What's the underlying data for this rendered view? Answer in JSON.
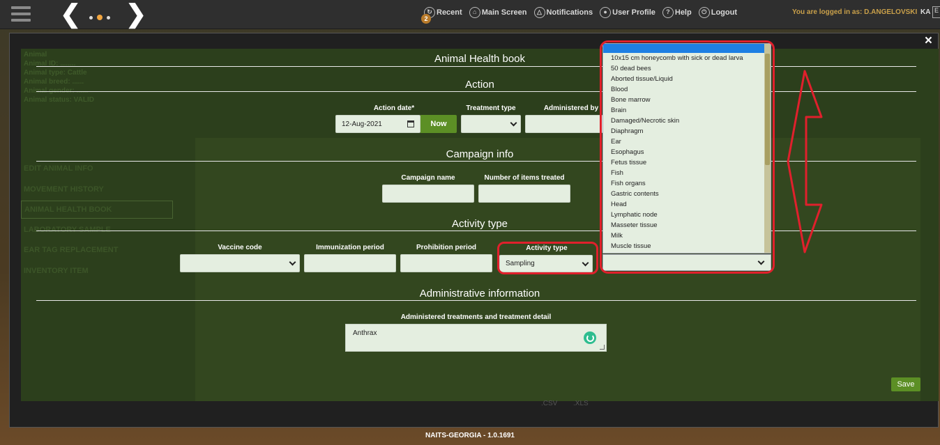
{
  "topbar": {
    "menu": [
      {
        "icon": "recent-icon",
        "label": "Recent",
        "badge": "2"
      },
      {
        "icon": "home-icon",
        "label": "Main Screen"
      },
      {
        "icon": "bell-icon",
        "label": "Notifications"
      },
      {
        "icon": "user-icon",
        "label": "User Profile"
      },
      {
        "icon": "help-icon",
        "label": "Help"
      },
      {
        "icon": "power-icon",
        "label": "Logout"
      }
    ],
    "logged_in": "You are logged in as: D.ANGELOVSKI",
    "lang": "KA",
    "lang_box": "E"
  },
  "background_page": {
    "menu_items": [
      "EDIT ANIMAL INFO",
      "MOVEMENT HISTORY",
      "ANIMAL HEALTH BOOK",
      "LABORATORY SAMPLE",
      "EAR TAG REPLACEMENT",
      "INVENTORY ITEM"
    ],
    "export_labels": [
      ".CSV",
      ".XLS"
    ]
  },
  "modal": {
    "title": "Animal Health book",
    "close": "×",
    "sections": {
      "action": "Action",
      "campaign": "Campaign info",
      "activity": "Activity type",
      "admin": "Administrative information"
    },
    "action": {
      "date_label": "Action date*",
      "date_value": "12-Aug-2021",
      "now_label": "Now",
      "treatment_label": "Treatment type",
      "administered_label": "Administered by"
    },
    "campaign": {
      "name_label": "Campaign name",
      "items_label": "Number of items treated"
    },
    "activity": {
      "vaccine_label": "Vaccine code",
      "immunization_label": "Immunization period",
      "prohibition_label": "Prohibition period",
      "activity_label": "Activity type",
      "activity_value": "Sampling"
    },
    "admin": {
      "detail_label": "Administered treatments and treatment detail",
      "detail_value": "Anthrax"
    },
    "save_label": "Save"
  },
  "dropdown": {
    "options": [
      "10x15 cm honeycomb with sick or dead larva",
      "50 dead bees",
      "Aborted tissue/Liquid",
      "Blood",
      "Bone marrow",
      "Brain",
      "Damaged/Necrotic skin",
      "Diaphragm",
      "Ear",
      "Esophagus",
      "Fetus tissue",
      "Fish",
      "Fish organs",
      "Gastric contents",
      "Head",
      "Lymphatic node",
      "Masseter tissue",
      "Milk",
      "Muscle tissue"
    ]
  },
  "footer": "NAITS-GEORGIA - 1.0.1691",
  "colors": {
    "accent_green": "#5c8f25",
    "highlight_red": "#e0202c",
    "selected_blue": "#1e7fe3"
  }
}
